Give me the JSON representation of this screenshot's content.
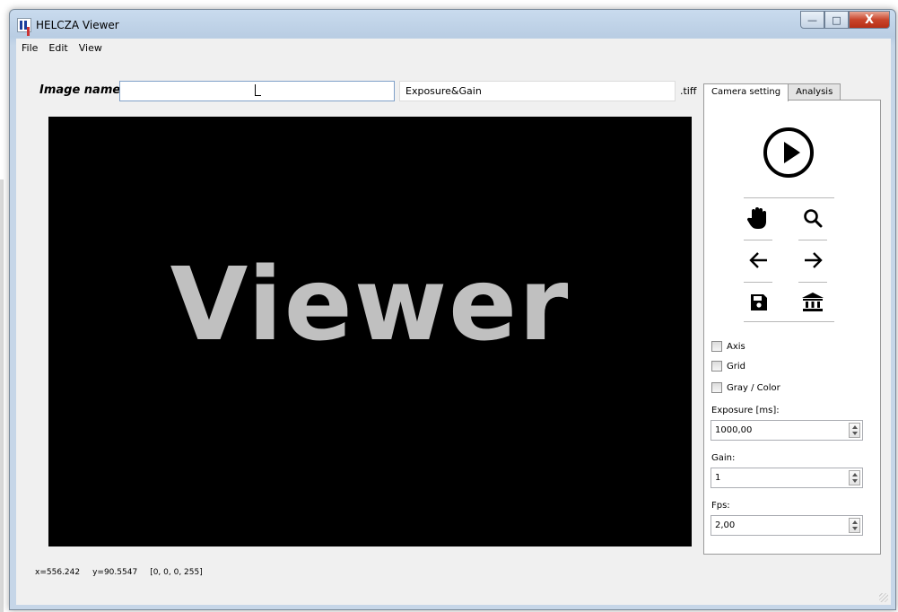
{
  "window": {
    "title": "HELCZA Viewer",
    "minimize_icon": "minimize-icon",
    "maximize_icon": "maximize-icon",
    "close_icon": "close-icon",
    "close_glyph": "X"
  },
  "menu": {
    "items": [
      {
        "label": "File"
      },
      {
        "label": "Edit"
      },
      {
        "label": "View"
      }
    ]
  },
  "image_name": {
    "label": "Image name:",
    "value": "",
    "suffix_value": "Exposure&Gain",
    "extension": ".tiff"
  },
  "image_view": {
    "display_text": "Viewer"
  },
  "status": {
    "x": "x=556.242",
    "y": "y=90.5547",
    "pixel": "[0, 0, 0, 255]"
  },
  "tabs": [
    {
      "label": "Camera setting",
      "active": true
    },
    {
      "label": "Analysis",
      "active": false
    }
  ],
  "toolbar": {
    "icons": [
      "play-icon",
      "pan-hand-icon",
      "zoom-icon",
      "back-arrow-icon",
      "forward-arrow-icon",
      "save-icon",
      "home-icon"
    ]
  },
  "checkboxes": [
    {
      "label": "Axis",
      "checked": false
    },
    {
      "label": "Grid",
      "checked": false
    },
    {
      "label": "Gray / Color",
      "checked": false
    }
  ],
  "fields": {
    "exposure": {
      "label": "Exposure [ms]:",
      "value": "1000,00"
    },
    "gain": {
      "label": "Gain:",
      "value": "1"
    },
    "fps": {
      "label": "Fps:",
      "value": "2,00"
    }
  }
}
